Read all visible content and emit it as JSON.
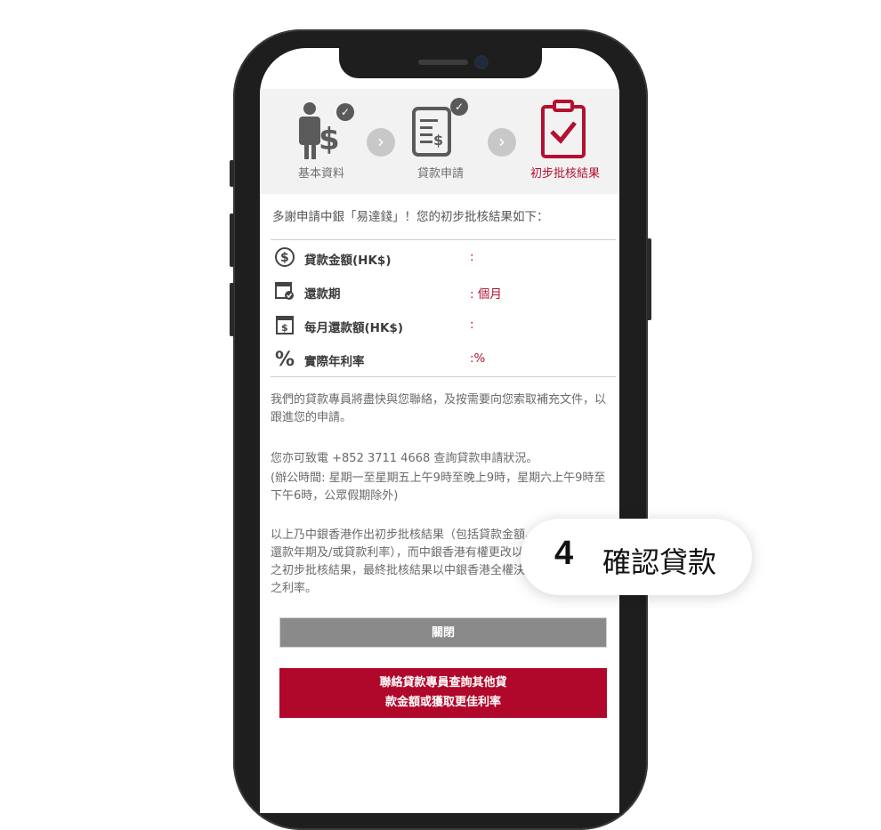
{
  "steps": [
    {
      "label": "基本資料",
      "done": true
    },
    {
      "label": "貸款申請",
      "done": true
    },
    {
      "label": "初步批核結果",
      "active": true
    }
  ],
  "intro": "多謝申請中銀「易達錢」！您的初步批核結果如下：",
  "result_rows": [
    {
      "icon": "dollar-circle-icon",
      "name": "貸款金額(HK$)",
      "value": ":"
    },
    {
      "icon": "calendar-check-icon",
      "name": "還款期",
      "value": ": 個月"
    },
    {
      "icon": "calendar-dollar-icon",
      "name": "每月還款額(HK$)",
      "value": ":"
    },
    {
      "icon": "percent-icon",
      "name": "實際年利率",
      "value": ":%"
    }
  ],
  "paragraphs": {
    "contact_note": "我們的貸款專員將盡快與您聯絡，及按需要向您索取補充文件，以跟進您的申請。",
    "phone_note": "您亦可致電 +852 3711 4668 查詢貸款申請狀況。",
    "hours_note": "(辦公時間: 星期一至星期五上午9時至晚上9時，星期六上午9時至下午6時，公眾假期除外)",
    "disclaimer": "以上乃中銀香港作出初步批核結果（包括貸款金額、還款年期及/或貸款利率），而中銀香港有權更改以上之初步批核結果，最終批核結果以中銀香港全權決定之利率。"
  },
  "buttons": {
    "close": "關閉",
    "contact_line1": "聯絡貸款專員查詢其他貸",
    "contact_line2": "款金額或獲取更佳利率"
  },
  "badge": {
    "number": "4",
    "text": "確認貸款"
  },
  "colors": {
    "accent": "#b0082b",
    "grey_button": "#8a8a8a"
  }
}
